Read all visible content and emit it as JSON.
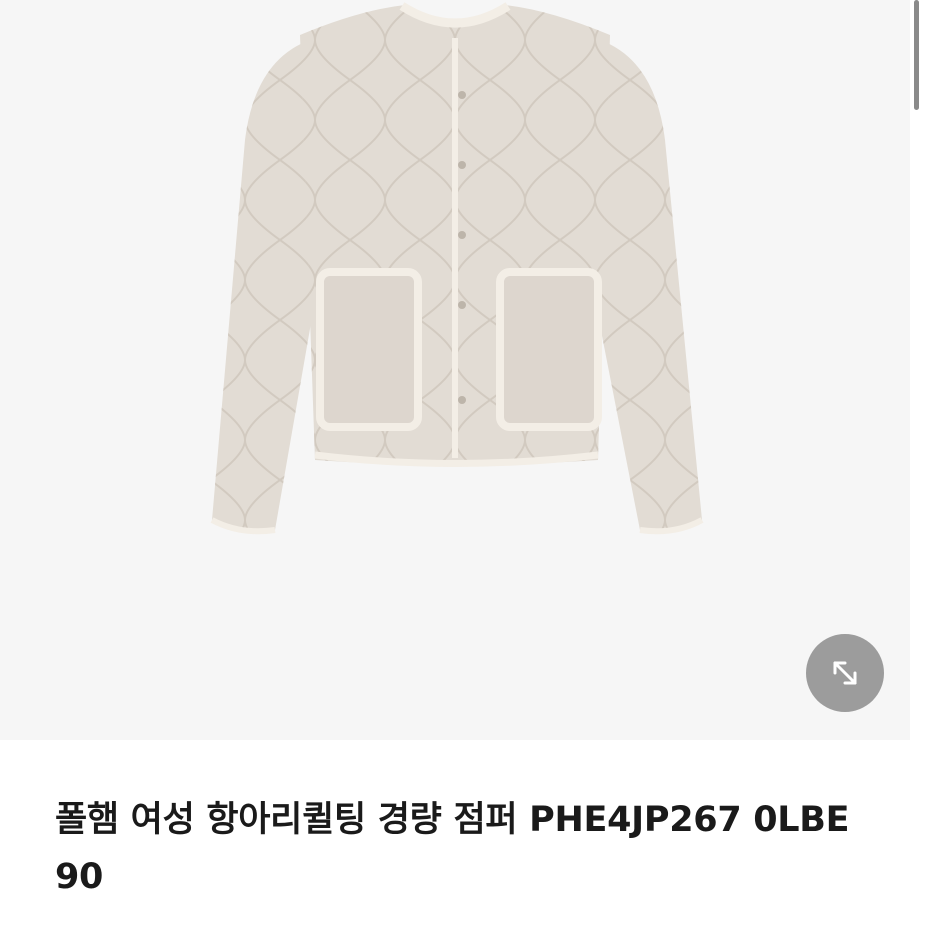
{
  "product": {
    "title": "폴햄 여성 항아리퀼팅 경량 점퍼 PHE4JP267 0LBE 90",
    "image_alt": "beige quilted lightweight jacket"
  },
  "controls": {
    "expand_icon": "expand-arrows-icon"
  },
  "colors": {
    "image_background": "#f6f6f6",
    "jacket_fabric": "#e2dcd4",
    "jacket_trim": "#f3eee6",
    "expand_button": "#8c8c8c"
  }
}
